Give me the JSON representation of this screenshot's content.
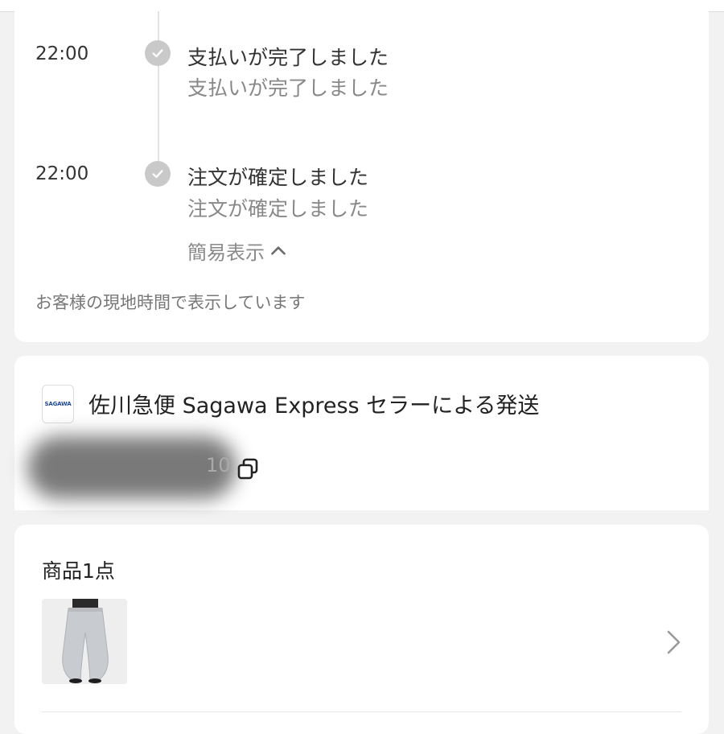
{
  "timeline": {
    "events": [
      {
        "time": "22:00",
        "title": "支払いが完了しました",
        "subtitle": "支払いが完了しました"
      },
      {
        "time": "22:00",
        "title": "注文が確定しました",
        "subtitle": "注文が確定しました"
      }
    ],
    "collapse_label": "簡易表示",
    "timezone_note": "お客様の現地時間で表示しています"
  },
  "shipping": {
    "carrier_logo_text": "SAGAWA",
    "carrier_line": "佐川急便 Sagawa Express セラーによる発送",
    "tracking_visible_tail": "10",
    "copy_icon": "copy-icon"
  },
  "items": {
    "count_label": "商品1点",
    "thumbnail_icon": "product-thumbnail",
    "chevron_icon": "chevron-right-icon"
  },
  "colors": {
    "card_bg": "#ffffff",
    "page_bg": "#f2f2f2",
    "check": "#c9c9c9",
    "muted_text": "#888888"
  }
}
